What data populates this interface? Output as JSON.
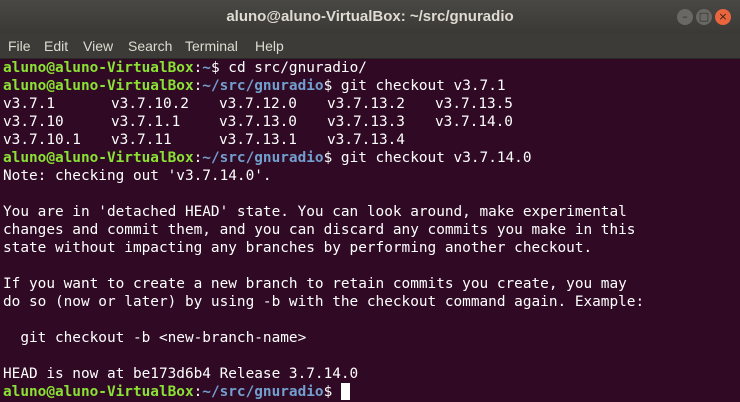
{
  "window": {
    "title": "aluno@aluno-VirtualBox: ~/src/gnuradio",
    "minimize_glyph": "–",
    "maximize_glyph": "□",
    "close_glyph": "×"
  },
  "menu": [
    "File",
    "Edit",
    "View",
    "Search",
    "Terminal",
    "Help"
  ],
  "prompt": {
    "user_host": "aluno@aluno-VirtualBox",
    "sep": ":",
    "home_path": "~",
    "repo_path": "~/src/gnuradio",
    "symbol": "$ "
  },
  "commands": [
    "cd src/gnuradio/",
    "git checkout v3.7.1",
    "git checkout v3.7.14.0"
  ],
  "tag_rows": [
    [
      "v3.7.1",
      "v3.7.10.2",
      "v3.7.12.0",
      "v3.7.13.2",
      "v3.7.13.5"
    ],
    [
      "v3.7.10",
      "v3.7.1.1",
      "v3.7.13.0",
      "v3.7.13.3",
      "v3.7.14.0"
    ],
    [
      "v3.7.10.1",
      "v3.7.11",
      "v3.7.13.1",
      "v3.7.13.4"
    ]
  ],
  "output": [
    "Note: checking out 'v3.7.14.0'.",
    "",
    "You are in 'detached HEAD' state. You can look around, make experimental",
    "changes and commit them, and you can discard any commits you make in this",
    "state without impacting any branches by performing another checkout.",
    "",
    "If you want to create a new branch to retain commits you create, you may",
    "do so (now or later) by using -b with the checkout command again. Example:",
    "",
    "  git checkout -b <new-branch-name>",
    "",
    "HEAD is now at be173d6b4 Release 3.7.14.0"
  ]
}
